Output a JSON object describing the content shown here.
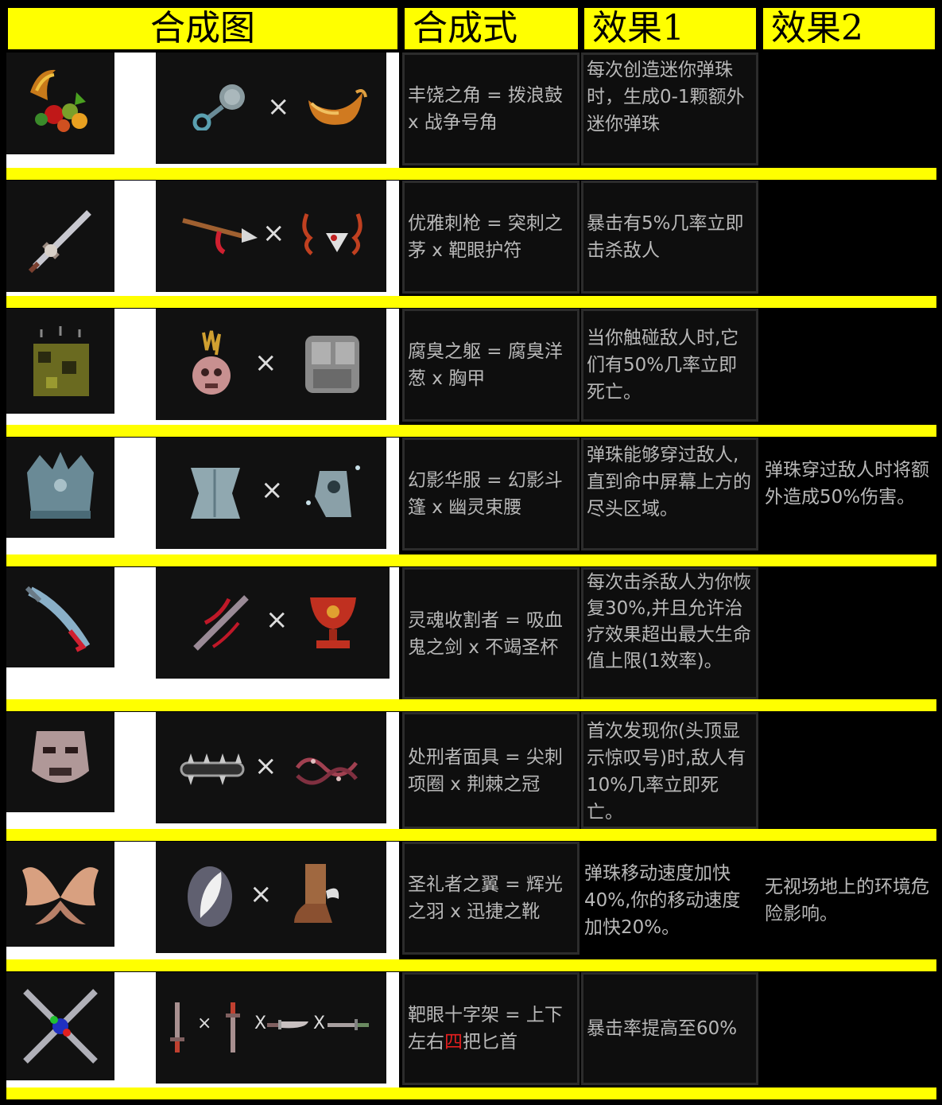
{
  "headers": [
    "合成图",
    "合成式",
    "效果1",
    "效果2"
  ],
  "colors": {
    "accent": "#ffff00",
    "background": "#000000",
    "text": "#b8b8b8",
    "highlight": "#e41f1f"
  },
  "times_symbol": "×",
  "times_small": "X",
  "rows": [
    {
      "result_icon": "cornucopia-icon",
      "ingredient_icons": [
        "rattle-drum-icon",
        "war-horn-icon"
      ],
      "formula": "丰饶之角 = 拨浪鼓 x 战争号角",
      "effect1": "每次创造迷你弹珠时，生成0-1颗额外迷你弹珠",
      "effect2": ""
    },
    {
      "result_icon": "elegant-rapier-icon",
      "ingredient_icons": [
        "thrusting-spear-icon",
        "bullseye-amulet-icon"
      ],
      "formula": "优雅刺枪 = 突刺之茅 x 靶眼护符",
      "effect1": "暴击有5%几率立即击杀敌人",
      "effect2": ""
    },
    {
      "result_icon": "rotten-body-icon",
      "ingredient_icons": [
        "rotten-onion-icon",
        "breastplate-icon"
      ],
      "formula": "腐臭之躯 = 腐臭洋葱 x 胸甲",
      "effect1": "当你触碰敌人时,它们有50%几率立即死亡。",
      "effect2": ""
    },
    {
      "result_icon": "phantom-robe-icon",
      "ingredient_icons": [
        "phantom-cloak-icon",
        "ghost-corset-icon"
      ],
      "formula": "幻影华服 = 幻影斗篷 x 幽灵束腰",
      "effect1": "弹珠能够穿过敌人,直到命中屏幕上方的尽头区域。",
      "effect2": "弹珠穿过敌人时将额外造成50%伤害。"
    },
    {
      "result_icon": "soul-reaper-icon",
      "ingredient_icons": [
        "vampire-sword-icon",
        "endless-grail-icon"
      ],
      "formula": "灵魂收割者 = 吸血鬼之剑 x 不竭圣杯",
      "effect1": "每次击杀敌人为你恢复30%,并且允许治疗效果超出最大生命值上限(1效率)。",
      "effect2": ""
    },
    {
      "result_icon": "executioner-mask-icon",
      "ingredient_icons": [
        "spiked-collar-icon",
        "thorn-crown-icon"
      ],
      "formula": "处刑者面具 = 尖刺项圈 x 荆棘之冠",
      "effect1": "首次发现你(头顶显示惊叹号)时,敌人有10%几率立即死亡。",
      "effect2": ""
    },
    {
      "result_icon": "saint-wings-icon",
      "ingredient_icons": [
        "radiant-feather-icon",
        "swift-boots-icon"
      ],
      "formula": "圣礼者之翼 = 辉光之羽 x 迅捷之靴",
      "effect1": "弹珠移动速度加快40%,你的移动速度加快20%。",
      "effect2": "无视场地上的环境危险影响。"
    },
    {
      "result_icon": "bullseye-cross-icon",
      "ingredient_icons": [
        "dagger-up-icon",
        "dagger-down-icon",
        "dagger-left-icon",
        "dagger-right-icon"
      ],
      "formula_parts": [
        "靶眼十字架 = 上下左右",
        "四",
        "把匕首"
      ],
      "effect1": "暴击率提高至60%",
      "effect2": ""
    }
  ]
}
